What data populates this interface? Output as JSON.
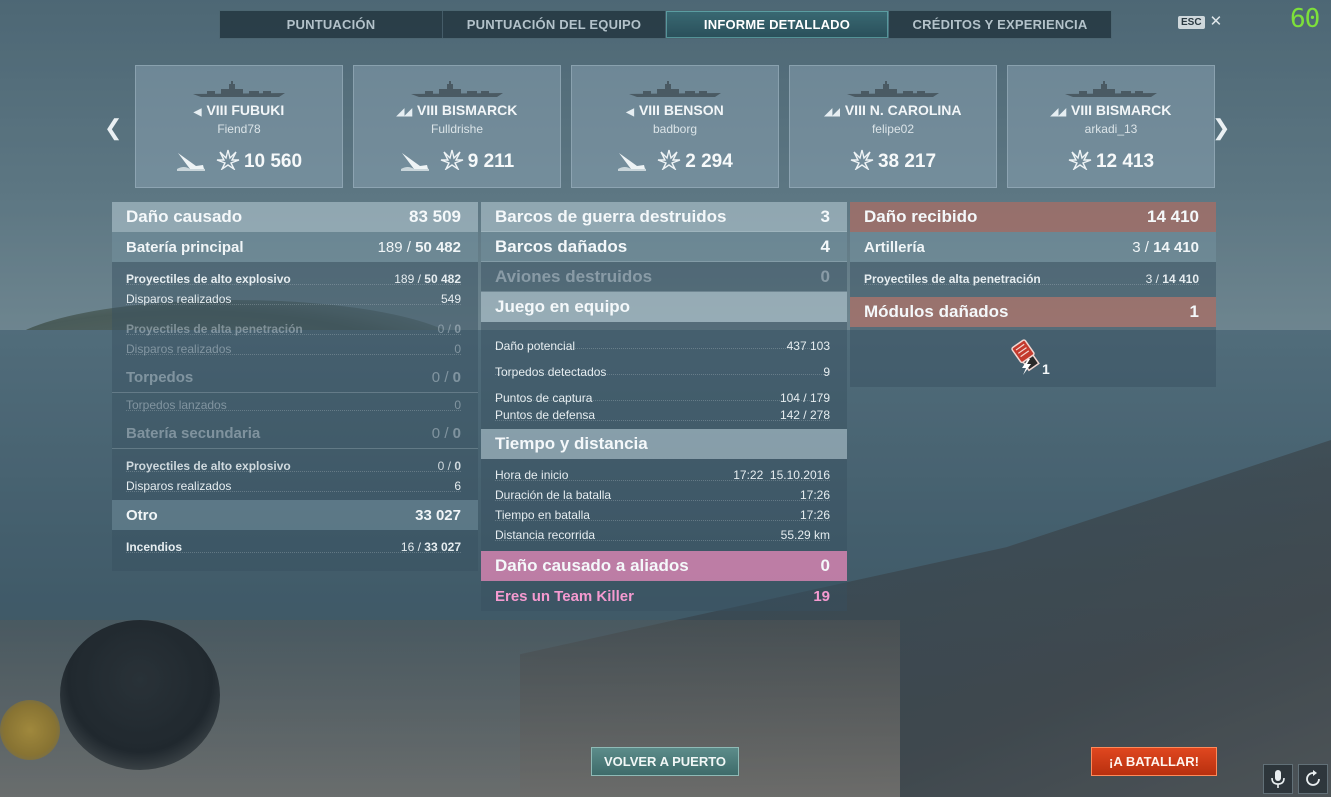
{
  "fps": "60",
  "tabs": [
    {
      "label": "PUNTUACIÓN",
      "active": false
    },
    {
      "label": "PUNTUACIÓN DEL EQUIPO",
      "active": false
    },
    {
      "label": "INFORME DETALLADO",
      "active": true
    },
    {
      "label": "CRÉDITOS Y EXPERIENCIA",
      "active": false
    }
  ],
  "esc": {
    "key": "ESC",
    "close": "✕"
  },
  "ships": [
    {
      "tier": "VIII",
      "name": "FUBUKI",
      "player": "Fiend78",
      "kill": true,
      "damage": "10 560"
    },
    {
      "tier": "VIII",
      "name": "BISMARCK",
      "player": "Fulldrishe",
      "kill": true,
      "damage": "9 211"
    },
    {
      "tier": "VIII",
      "name": "BENSON",
      "player": "badborg",
      "kill": true,
      "damage": "2 294"
    },
    {
      "tier": "VIII",
      "name": "N. CAROLINA",
      "player": "felipe02",
      "kill": false,
      "damage": "38 217"
    },
    {
      "tier": "VIII",
      "name": "BISMARCK",
      "player": "arkadi_13",
      "kill": false,
      "damage": "12 413"
    }
  ],
  "left": {
    "header": {
      "label": "Daño causado",
      "value": "83 509"
    },
    "main_battery": {
      "label": "Batería principal",
      "hits": "189",
      "sep": "/",
      "dmg": "50 482"
    },
    "he": {
      "label": "Proyectiles de alto explosivo",
      "hits": "189",
      "sep": "/",
      "dmg": "50 482"
    },
    "he_shots": {
      "label": "Disparos realizados",
      "value": "549"
    },
    "ap": {
      "label": "Proyectiles de alta penetración",
      "hits": "0",
      "sep": "/",
      "dmg": "0"
    },
    "ap_shots": {
      "label": "Disparos realizados",
      "value": "0"
    },
    "torps": {
      "label": "Torpedos",
      "hits": "0",
      "sep": "/",
      "dmg": "0"
    },
    "torps_launched": {
      "label": "Torpedos lanzados",
      "value": "0"
    },
    "secondary": {
      "label": "Batería secundaria",
      "hits": "0",
      "sep": "/",
      "dmg": "0"
    },
    "sec_he": {
      "label": "Proyectiles de alto explosivo",
      "hits": "0",
      "sep": "/",
      "dmg": "0"
    },
    "sec_shots": {
      "label": "Disparos realizados",
      "value": "6"
    },
    "other": {
      "label": "Otro",
      "value": "33 027"
    },
    "fires": {
      "label": "Incendios",
      "hits": "16",
      "sep": "/",
      "dmg": "33 027"
    }
  },
  "middle": {
    "destroyed": {
      "label": "Barcos de guerra destruidos",
      "value": "3"
    },
    "damaged": {
      "label": "Barcos dañados",
      "value": "4"
    },
    "planes": {
      "label": "Aviones destruidos",
      "value": "0"
    },
    "team_header": "Juego en equipo",
    "potential": {
      "label": "Daño potencial",
      "value": "437 103"
    },
    "torp_spotted": {
      "label": "Torpedos detectados",
      "value": "9"
    },
    "capture": {
      "label": "Puntos de captura",
      "value": "104 / 179"
    },
    "defense": {
      "label": "Puntos de defensa",
      "value": "142 / 278"
    },
    "time_header": "Tiempo y distancia",
    "start": {
      "label": "Hora de inicio",
      "value": "17:22  15.10.2016"
    },
    "duration": {
      "label": "Duración de la batalla",
      "value": "17:26"
    },
    "in_battle": {
      "label": "Tiempo en batalla",
      "value": "17:26"
    },
    "distance": {
      "label": "Distancia recorrida",
      "value": "55.29 km"
    },
    "allies": {
      "label": "Daño causado a aliados",
      "value": "0"
    },
    "tk": {
      "label": "Eres un Team Killer",
      "value": "19"
    }
  },
  "right": {
    "received": {
      "label": "Daño recibido",
      "value": "14 410"
    },
    "artillery": {
      "label": "Artillería",
      "hits": "3",
      "sep": "/",
      "dmg": "14 410"
    },
    "ap": {
      "label": "Proyectiles de alta penetración",
      "hits": "3",
      "sep": "/",
      "dmg": "14 410"
    },
    "modules": {
      "label": "Módulos dañados",
      "value": "1"
    },
    "module_count": "1"
  },
  "buttons": {
    "port": "VOLVER A PUERTO",
    "battle": "¡A BATALLAR!"
  },
  "colors": {
    "accent": "#3e6b6a",
    "battle": "#c9380f",
    "fps": "#7de03a",
    "team_killer": "#f59ad0",
    "received": "#aa6e64"
  }
}
